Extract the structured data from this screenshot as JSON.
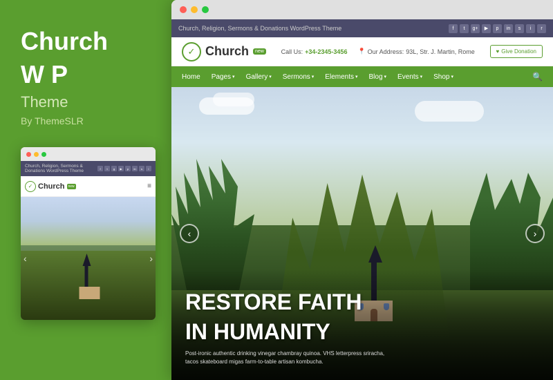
{
  "left": {
    "title_line1": "Church",
    "title_line2": "W P",
    "subtitle": "Theme",
    "by": "By ThemeSLR"
  },
  "topbar": {
    "text": "Church, Religion, Sermons & Donations WordPress Theme",
    "social_icons": [
      "f",
      "t",
      "g+",
      "yt",
      "pin",
      "in",
      "sk",
      "ig",
      "rss"
    ]
  },
  "header": {
    "logo_text": "Church",
    "logo_badge": "new",
    "phone_label": "Call Us:",
    "phone_number": "+34-2345-3456",
    "address_label": "Our Address:",
    "address_text": "93L, Str. J. Martin, Rome",
    "donate_heart": "♥",
    "donate_label": "Give Donation"
  },
  "nav": {
    "items": [
      {
        "label": "Home",
        "has_arrow": false
      },
      {
        "label": "Pages",
        "has_arrow": true
      },
      {
        "label": "Gallery",
        "has_arrow": true
      },
      {
        "label": "Sermons",
        "has_arrow": true
      },
      {
        "label": "Elements",
        "has_arrow": true
      },
      {
        "label": "Blog",
        "has_arrow": true
      },
      {
        "label": "Events",
        "has_arrow": true
      },
      {
        "label": "Shop",
        "has_arrow": true
      }
    ]
  },
  "hero": {
    "main_text_line1": "RESTORE FAITH",
    "main_text_line2": "IN HUMANITY",
    "sub_text": "Post-ironic authentic drinking vinegar chambray quinoa. VHS letterpress sriracha, tacos skateboard migas farm-to-table artisan kombucha.",
    "prev_arrow": "‹",
    "next_arrow": "›"
  }
}
